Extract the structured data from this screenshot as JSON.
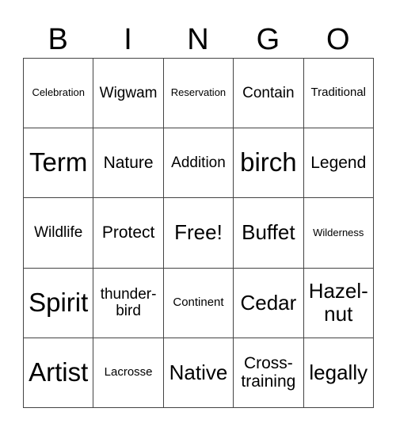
{
  "header": {
    "letters": [
      "B",
      "I",
      "N",
      "G",
      "O"
    ]
  },
  "grid": {
    "rows": [
      [
        "Celebration",
        "Wigwam",
        "Reservation",
        "Contain",
        "Traditional"
      ],
      [
        "Term",
        "Nature",
        "Addition",
        "birch",
        "Legend"
      ],
      [
        "Wildlife",
        "Protect",
        "Free!",
        "Buffet",
        "Wilderness"
      ],
      [
        "Spirit",
        "thunder-\nbird",
        "Continent",
        "Cedar",
        "Hazel-\nnut"
      ],
      [
        "Artist",
        "Lacrosse",
        "Native",
        "Cross-\ntraining",
        "legally"
      ]
    ]
  },
  "free_space": "Free!"
}
